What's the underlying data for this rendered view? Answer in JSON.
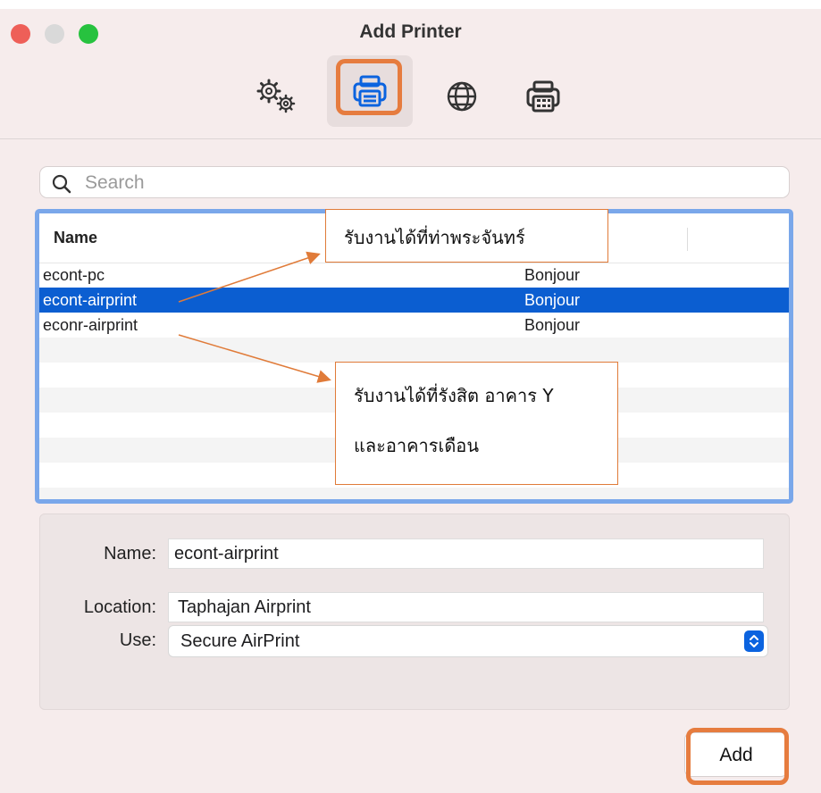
{
  "window": {
    "title": "Add Printer"
  },
  "toolbar": {
    "items": [
      "default-tab",
      "ip-tab",
      "windows-tab",
      "advanced-tab"
    ]
  },
  "search": {
    "placeholder": "Search",
    "value": ""
  },
  "printer_list": {
    "column_name": "Name",
    "rows": [
      {
        "name": "econt-pc",
        "kind": "Bonjour",
        "selected": false
      },
      {
        "name": "econt-airprint",
        "kind": "Bonjour",
        "selected": true
      },
      {
        "name": "econr-airprint",
        "kind": "Bonjour",
        "selected": false
      }
    ]
  },
  "details": {
    "name_label": "Name:",
    "name_value": "econt-airprint",
    "location_label": "Location:",
    "location_value": "Taphajan Airprint",
    "use_label": "Use:",
    "use_value": "Secure AirPrint"
  },
  "actions": {
    "add_label": "Add"
  },
  "annotations": {
    "callout_a": "รับงานได้ที่ท่าพระจันทร์",
    "callout_b_line1": "รับงานได้ที่รังสิต อาคาร Y",
    "callout_b_line2": "และอาคารเดือน"
  },
  "colors": {
    "selection": "#0b5ed1",
    "highlight": "#e67c3f",
    "list_border": "#7aa7ea"
  }
}
